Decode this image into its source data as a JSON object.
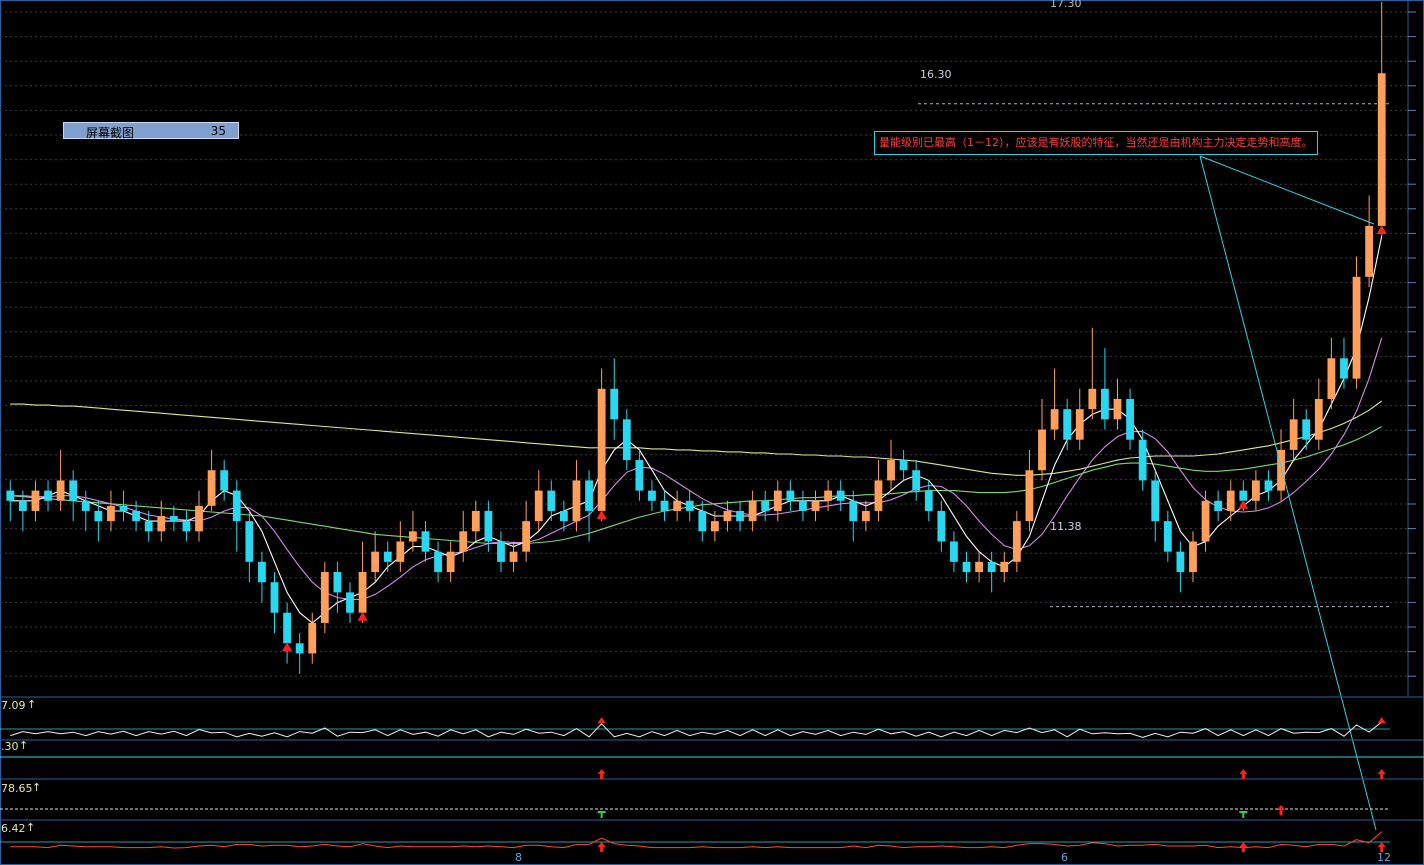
{
  "badge": {
    "label": "屏幕截图",
    "value": "35"
  },
  "annotation": "量能级别已最高（1－12），应该是有妖股的特征，当然还是由机构主力决定走势和高度。",
  "price_labels": {
    "top": "17.30",
    "high_line": "16.30",
    "low_line": "11.38"
  },
  "panels": [
    {
      "label": "7.09"
    },
    {
      "label": ".30"
    },
    {
      "label": "78.65"
    },
    {
      "label": "6.42"
    }
  ],
  "bottom_marks": [
    "8",
    "6",
    "12"
  ],
  "colors": {
    "up": "#ff9f5a",
    "down": "#28d8f0",
    "ma_short": "#ffffff",
    "ma_mid": "#d58ce8",
    "ma_long1": "#d8e88c",
    "ma_long2": "#7ed870",
    "signal": "#ff2020",
    "grid": "#3a3a46",
    "frame": "#2a62a0",
    "annotation_border": "#34d0e0"
  },
  "chart_data": {
    "type": "candlestick",
    "ylim": [
      10.6,
      17.3
    ],
    "candles": [
      [
        12.5,
        12.4,
        12.6,
        12.2
      ],
      [
        12.4,
        12.3,
        12.5,
        12.1
      ],
      [
        12.3,
        12.5,
        12.6,
        12.2
      ],
      [
        12.5,
        12.4,
        12.6,
        12.3
      ],
      [
        12.4,
        12.6,
        12.9,
        12.3
      ],
      [
        12.6,
        12.4,
        12.7,
        12.2
      ],
      [
        12.4,
        12.3,
        12.5,
        12.1
      ],
      [
        12.3,
        12.2,
        12.4,
        12.0
      ],
      [
        12.2,
        12.35,
        12.5,
        12.1
      ],
      [
        12.35,
        12.3,
        12.5,
        12.2
      ],
      [
        12.3,
        12.2,
        12.4,
        12.1
      ],
      [
        12.2,
        12.1,
        12.3,
        12.0
      ],
      [
        12.1,
        12.25,
        12.4,
        12.0
      ],
      [
        12.25,
        12.2,
        12.35,
        12.1
      ],
      [
        12.2,
        12.1,
        12.3,
        12.0
      ],
      [
        12.1,
        12.35,
        12.5,
        12.0
      ],
      [
        12.35,
        12.7,
        12.9,
        12.3
      ],
      [
        12.7,
        12.5,
        12.8,
        12.4
      ],
      [
        12.5,
        12.2,
        12.6,
        11.9
      ],
      [
        12.2,
        11.8,
        12.3,
        11.6
      ],
      [
        11.8,
        11.6,
        11.9,
        11.4
      ],
      [
        11.6,
        11.3,
        11.7,
        11.1
      ],
      [
        11.3,
        11.0,
        11.4,
        10.8
      ],
      [
        11.0,
        10.9,
        11.1,
        10.7
      ],
      [
        10.9,
        11.2,
        11.3,
        10.8
      ],
      [
        11.2,
        11.7,
        11.8,
        11.1
      ],
      [
        11.7,
        11.5,
        11.8,
        11.3
      ],
      [
        11.5,
        11.3,
        11.6,
        11.2
      ],
      [
        11.3,
        11.7,
        12.0,
        11.2
      ],
      [
        11.7,
        11.9,
        12.1,
        11.6
      ],
      [
        11.9,
        11.8,
        12.0,
        11.7
      ],
      [
        11.8,
        12.0,
        12.2,
        11.7
      ],
      [
        12.0,
        12.1,
        12.3,
        11.9
      ],
      [
        12.1,
        11.9,
        12.2,
        11.8
      ],
      [
        11.9,
        11.7,
        12.0,
        11.6
      ],
      [
        11.7,
        11.9,
        12.0,
        11.6
      ],
      [
        11.9,
        12.1,
        12.3,
        11.8
      ],
      [
        12.1,
        12.3,
        12.4,
        12.0
      ],
      [
        12.3,
        12.0,
        12.4,
        11.9
      ],
      [
        12.0,
        11.8,
        12.1,
        11.7
      ],
      [
        11.8,
        11.9,
        12.0,
        11.7
      ],
      [
        11.9,
        12.2,
        12.4,
        11.8
      ],
      [
        12.2,
        12.5,
        12.7,
        12.1
      ],
      [
        12.5,
        12.3,
        12.6,
        12.2
      ],
      [
        12.3,
        12.2,
        12.4,
        12.1
      ],
      [
        12.2,
        12.6,
        12.8,
        12.1
      ],
      [
        12.6,
        12.3,
        12.7,
        12.0
      ],
      [
        12.3,
        13.5,
        13.7,
        12.2
      ],
      [
        13.5,
        13.2,
        13.8,
        13.0
      ],
      [
        13.2,
        12.8,
        13.3,
        12.7
      ],
      [
        12.8,
        12.5,
        12.9,
        12.4
      ],
      [
        12.5,
        12.4,
        12.6,
        12.3
      ],
      [
        12.4,
        12.3,
        12.5,
        12.2
      ],
      [
        12.3,
        12.4,
        12.5,
        12.2
      ],
      [
        12.4,
        12.3,
        12.5,
        12.2
      ],
      [
        12.3,
        12.1,
        12.4,
        12.0
      ],
      [
        12.1,
        12.2,
        12.3,
        12.0
      ],
      [
        12.2,
        12.3,
        12.4,
        12.1
      ],
      [
        12.3,
        12.2,
        12.4,
        12.1
      ],
      [
        12.2,
        12.4,
        12.5,
        12.1
      ],
      [
        12.4,
        12.3,
        12.5,
        12.2
      ],
      [
        12.3,
        12.5,
        12.6,
        12.2
      ],
      [
        12.5,
        12.4,
        12.6,
        12.3
      ],
      [
        12.4,
        12.3,
        12.5,
        12.2
      ],
      [
        12.3,
        12.4,
        12.5,
        12.2
      ],
      [
        12.4,
        12.5,
        12.6,
        12.3
      ],
      [
        12.5,
        12.4,
        12.6,
        12.3
      ],
      [
        12.4,
        12.2,
        12.5,
        12.0
      ],
      [
        12.2,
        12.3,
        12.4,
        12.1
      ],
      [
        12.3,
        12.6,
        12.8,
        12.2
      ],
      [
        12.6,
        12.8,
        13.0,
        12.5
      ],
      [
        12.8,
        12.7,
        12.9,
        12.6
      ],
      [
        12.7,
        12.5,
        12.8,
        12.4
      ],
      [
        12.5,
        12.3,
        12.6,
        12.2
      ],
      [
        12.3,
        12.0,
        12.4,
        11.9
      ],
      [
        12.0,
        11.8,
        12.1,
        11.7
      ],
      [
        11.8,
        11.7,
        11.9,
        11.6
      ],
      [
        11.7,
        11.8,
        11.9,
        11.6
      ],
      [
        11.8,
        11.7,
        11.9,
        11.5
      ],
      [
        11.7,
        11.8,
        11.9,
        11.6
      ],
      [
        11.8,
        12.2,
        12.3,
        11.7
      ],
      [
        12.2,
        12.7,
        12.9,
        12.1
      ],
      [
        12.7,
        13.1,
        13.4,
        12.6
      ],
      [
        13.1,
        13.3,
        13.7,
        13.0
      ],
      [
        13.3,
        13.0,
        13.4,
        12.9
      ],
      [
        13.0,
        13.3,
        13.5,
        12.9
      ],
      [
        13.3,
        13.5,
        14.1,
        13.2
      ],
      [
        13.5,
        13.2,
        13.9,
        13.1
      ],
      [
        13.2,
        13.4,
        13.6,
        13.1
      ],
      [
        13.4,
        13.0,
        13.5,
        12.9
      ],
      [
        13.0,
        12.6,
        13.1,
        12.5
      ],
      [
        12.6,
        12.2,
        12.7,
        12.0
      ],
      [
        12.2,
        11.9,
        12.3,
        11.8
      ],
      [
        11.9,
        11.7,
        12.0,
        11.5
      ],
      [
        11.7,
        12.0,
        12.1,
        11.6
      ],
      [
        12.0,
        12.4,
        12.5,
        11.9
      ],
      [
        12.4,
        12.3,
        12.5,
        12.2
      ],
      [
        12.3,
        12.5,
        12.6,
        12.2
      ],
      [
        12.5,
        12.4,
        12.6,
        12.3
      ],
      [
        12.4,
        12.6,
        12.7,
        12.3
      ],
      [
        12.6,
        12.5,
        12.7,
        12.4
      ],
      [
        12.5,
        12.9,
        13.1,
        12.4
      ],
      [
        12.9,
        13.2,
        13.4,
        12.8
      ],
      [
        13.2,
        13.0,
        13.3,
        12.9
      ],
      [
        13.0,
        13.4,
        13.6,
        12.9
      ],
      [
        13.4,
        13.8,
        14.0,
        13.3
      ],
      [
        13.8,
        13.6,
        14.0,
        13.5
      ],
      [
        13.6,
        14.6,
        14.8,
        13.5
      ],
      [
        14.6,
        15.1,
        15.4,
        14.5
      ],
      [
        15.1,
        16.6,
        17.3,
        15.0
      ]
    ],
    "ma_short": [
      12.4,
      12.4,
      12.4,
      12.45,
      12.5,
      12.45,
      12.4,
      12.35,
      12.3,
      12.3,
      12.25,
      12.2,
      12.2,
      12.2,
      12.2,
      12.25,
      12.4,
      12.5,
      12.45,
      12.3,
      12.1,
      11.8,
      11.5,
      11.3,
      11.2,
      11.3,
      11.4,
      11.45,
      11.5,
      11.6,
      11.75,
      11.85,
      11.95,
      11.95,
      11.9,
      11.85,
      11.9,
      12.0,
      12.05,
      12.0,
      11.95,
      12.0,
      12.1,
      12.25,
      12.3,
      12.35,
      12.4,
      12.7,
      12.9,
      13.0,
      12.9,
      12.7,
      12.5,
      12.4,
      12.35,
      12.3,
      12.25,
      12.25,
      12.25,
      12.25,
      12.3,
      12.35,
      12.4,
      12.4,
      12.4,
      12.4,
      12.45,
      12.4,
      12.35,
      12.4,
      12.5,
      12.6,
      12.65,
      12.6,
      12.45,
      12.25,
      12.05,
      11.9,
      11.8,
      11.75,
      11.85,
      12.05,
      12.4,
      12.75,
      13.0,
      13.15,
      13.25,
      13.3,
      13.3,
      13.2,
      13.0,
      12.7,
      12.4,
      12.1,
      11.95,
      12.0,
      12.15,
      12.25,
      12.35,
      12.45,
      12.5,
      12.6,
      12.8,
      12.95,
      13.1,
      13.35,
      13.6,
      13.9,
      14.4,
      15.0
    ],
    "ma_mid": [
      12.45,
      12.45,
      12.44,
      12.44,
      12.45,
      12.45,
      12.43,
      12.4,
      12.37,
      12.34,
      12.3,
      12.26,
      12.24,
      12.22,
      12.21,
      12.2,
      12.24,
      12.3,
      12.34,
      12.33,
      12.25,
      12.1,
      11.92,
      11.75,
      11.6,
      11.5,
      11.45,
      11.43,
      11.43,
      11.48,
      11.56,
      11.65,
      11.75,
      11.82,
      11.86,
      11.88,
      11.9,
      11.94,
      11.98,
      12.0,
      11.99,
      11.99,
      12.02,
      12.08,
      12.14,
      12.2,
      12.26,
      12.4,
      12.55,
      12.68,
      12.73,
      12.72,
      12.66,
      12.58,
      12.5,
      12.42,
      12.36,
      12.31,
      12.28,
      12.26,
      12.26,
      12.27,
      12.29,
      12.31,
      12.33,
      12.35,
      12.37,
      12.38,
      12.38,
      12.38,
      12.41,
      12.46,
      12.52,
      12.55,
      12.54,
      12.47,
      12.35,
      12.2,
      12.07,
      11.96,
      11.92,
      11.96,
      12.07,
      12.25,
      12.45,
      12.63,
      12.8,
      12.93,
      13.03,
      13.08,
      13.08,
      13.01,
      12.88,
      12.7,
      12.53,
      12.41,
      12.34,
      12.3,
      12.29,
      12.3,
      12.33,
      12.39,
      12.48,
      12.59,
      12.71,
      12.86,
      13.05,
      13.28,
      13.6,
      14.0
    ],
    "ma_long1": [
      13.35,
      13.35,
      13.34,
      13.34,
      13.33,
      13.33,
      13.32,
      13.31,
      13.3,
      13.29,
      13.28,
      13.27,
      13.26,
      13.25,
      13.24,
      13.23,
      13.22,
      13.21,
      13.2,
      13.19,
      13.18,
      13.17,
      13.16,
      13.15,
      13.14,
      13.13,
      13.12,
      13.11,
      13.1,
      13.09,
      13.08,
      13.07,
      13.06,
      13.05,
      13.04,
      13.03,
      13.02,
      13.01,
      13.0,
      12.99,
      12.98,
      12.97,
      12.96,
      12.95,
      12.94,
      12.93,
      12.92,
      12.92,
      12.92,
      12.92,
      12.92,
      12.91,
      12.91,
      12.9,
      12.9,
      12.89,
      12.89,
      12.88,
      12.88,
      12.87,
      12.87,
      12.86,
      12.86,
      12.85,
      12.85,
      12.84,
      12.84,
      12.83,
      12.83,
      12.82,
      12.81,
      12.8,
      12.79,
      12.77,
      12.75,
      12.73,
      12.71,
      12.69,
      12.67,
      12.66,
      12.65,
      12.65,
      12.66,
      12.67,
      12.69,
      12.71,
      12.74,
      12.77,
      12.8,
      12.82,
      12.83,
      12.84,
      12.84,
      12.84,
      12.84,
      12.85,
      12.86,
      12.88,
      12.9,
      12.92,
      12.94,
      12.97,
      13.0,
      13.03,
      13.07,
      13.11,
      13.16,
      13.22,
      13.29,
      13.38
    ],
    "ma_long2": [
      12.45,
      12.44,
      12.43,
      12.42,
      12.41,
      12.4,
      12.39,
      12.38,
      12.37,
      12.36,
      12.35,
      12.34,
      12.33,
      12.32,
      12.31,
      12.3,
      12.29,
      12.28,
      12.27,
      12.26,
      12.25,
      12.23,
      12.21,
      12.19,
      12.17,
      12.15,
      12.13,
      12.11,
      12.09,
      12.07,
      12.06,
      12.05,
      12.04,
      12.03,
      12.02,
      12.01,
      12.0,
      11.99,
      11.98,
      11.98,
      11.98,
      11.98,
      11.99,
      12.0,
      12.02,
      12.05,
      12.08,
      12.12,
      12.16,
      12.2,
      12.24,
      12.27,
      12.3,
      12.32,
      12.34,
      12.36,
      12.37,
      12.38,
      12.39,
      12.4,
      12.4,
      12.41,
      12.42,
      12.43,
      12.43,
      12.44,
      12.45,
      12.45,
      12.46,
      12.46,
      12.47,
      12.48,
      12.49,
      12.5,
      12.5,
      12.5,
      12.49,
      12.48,
      12.48,
      12.48,
      12.49,
      12.51,
      12.54,
      12.58,
      12.62,
      12.66,
      12.7,
      12.73,
      12.76,
      12.77,
      12.77,
      12.76,
      12.74,
      12.72,
      12.7,
      12.69,
      12.69,
      12.7,
      12.71,
      12.73,
      12.75,
      12.77,
      12.8,
      12.83,
      12.87,
      12.91,
      12.95,
      13.0,
      13.06,
      13.13
    ],
    "signals_main": [
      22,
      28,
      47,
      98,
      109
    ],
    "signals_panel2": [
      47,
      98,
      109
    ],
    "signals_panel3_up": [
      101
    ],
    "signals_panel3_down": [
      47,
      98
    ],
    "signals_panel4": [
      47,
      98,
      109
    ]
  }
}
